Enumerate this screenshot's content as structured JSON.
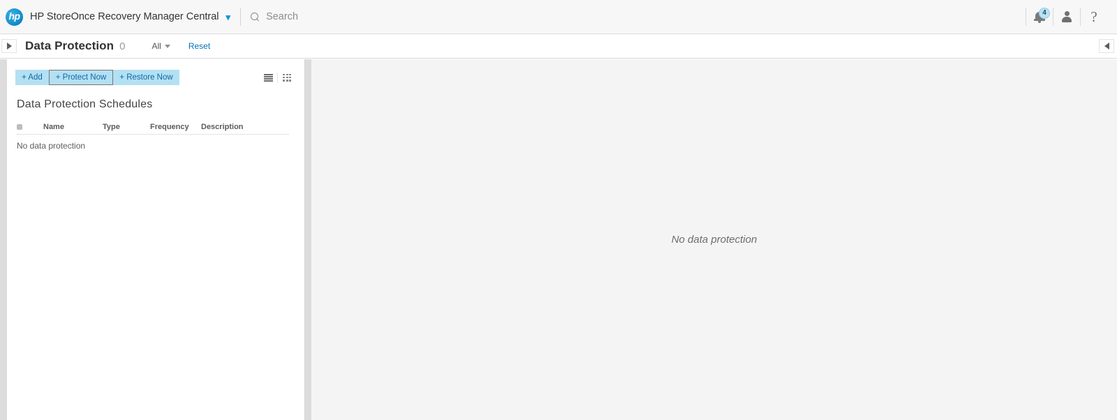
{
  "topbar": {
    "logo_text": "hp",
    "logo_name": "hp-logo",
    "brand_title": "HP StoreOnce Recovery Manager Central",
    "brand_caret": "▾",
    "search": {
      "placeholder": "Search",
      "value": "",
      "icon": "search-icon"
    },
    "icons": {
      "notifications": {
        "name": "bell-icon",
        "badge_count": "4",
        "badge_color": "#b9e3f5"
      },
      "user": {
        "name": "user-icon"
      },
      "help": {
        "name": "help-icon",
        "glyph": "?"
      }
    }
  },
  "subheader": {
    "expand_toggle": {
      "name": "expand-panel-arrow",
      "glyph": "▶"
    },
    "title": "Data Protection",
    "count": "0",
    "filter": {
      "label": "All",
      "options": [
        "All"
      ]
    },
    "reset_label": "Reset",
    "collapse_toggle": {
      "name": "collapse-panel-arrow",
      "glyph": "◀"
    }
  },
  "left_panel": {
    "actions": [
      {
        "label": "+ Add",
        "name": "add-button",
        "focused": false
      },
      {
        "label": "+ Protect Now",
        "name": "protect-now-button",
        "focused": true
      },
      {
        "label": "+ Restore Now",
        "name": "restore-now-button",
        "focused": false
      }
    ],
    "view_toggles": [
      {
        "name": "list-view-toggle"
      },
      {
        "name": "grid-view-toggle"
      }
    ],
    "section_title": "Data Protection Schedules",
    "table": {
      "columns": [
        "",
        "Name",
        "Type",
        "Frequency",
        "Description"
      ],
      "rows": [],
      "empty_text": "No data protection"
    }
  },
  "right_panel": {
    "empty_text": "No data protection"
  },
  "colors": {
    "accent": "#0073bb",
    "brand_blue": "#0096d6",
    "action_bg": "#b3e0f2",
    "panel_bg": "#f4f4f4",
    "topbar_bg": "#f7f7f7"
  }
}
